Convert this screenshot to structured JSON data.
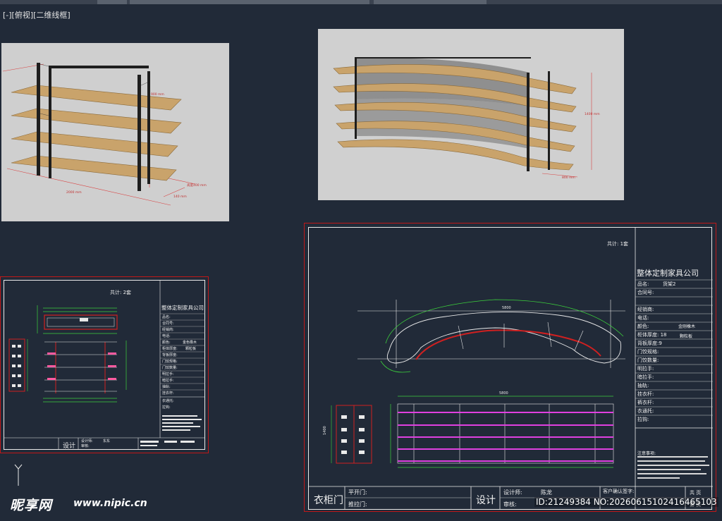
{
  "viewport": {
    "label": "[-][俯视][二维线框]"
  },
  "render_left": {
    "dims": {
      "height": "900 mm",
      "length": "2000 mm",
      "depth": "140 mm",
      "side": "高度400 mm"
    }
  },
  "render_right": {
    "dims": {
      "height": "1400 mm",
      "depth": "800 mm"
    }
  },
  "sheet_small": {
    "count": "共计: 2套",
    "company": "整体定制家具公司",
    "rows": [
      "品名:",
      "合同号:",
      "经销商:",
      "电话:",
      "颜色:",
      "柜体厚度:",
      "背板厚度:",
      "门饺规格:",
      "门饺数量:",
      "明拉手:",
      "暗拉手:",
      "抽轨:",
      "挂衣杆:",
      "衣通托:",
      "拉钩:"
    ],
    "color_value": "金色橡木",
    "board_value": "颗粒板",
    "design_label": "设计",
    "designer_label": "设计师:",
    "designer_value": "东东",
    "review_label": "审核:"
  },
  "sheet_large": {
    "count": "共计: 1套",
    "company": "整体定制家具公司",
    "rows": [
      {
        "label": "品名:",
        "value": "货架2"
      },
      {
        "label": "合同号:",
        "value": ""
      },
      {
        "label": "经销商:",
        "value": ""
      },
      {
        "label": "电话:",
        "value": ""
      },
      {
        "label": "颜色:",
        "value": "金刚橡木"
      },
      {
        "label": "柜体厚度: 18",
        "value": "颗粒板"
      },
      {
        "label": "背板厚度:9",
        "value": ""
      },
      {
        "label": "门饺规格:",
        "value": ""
      },
      {
        "label": "门饺数量:",
        "value": ""
      },
      {
        "label": "明拉手:",
        "value": ""
      },
      {
        "label": "暗拉手:",
        "value": ""
      },
      {
        "label": "抽轨:",
        "value": ""
      },
      {
        "label": "挂衣杆:",
        "value": ""
      },
      {
        "label": "裤衣杆:",
        "value": ""
      },
      {
        "label": "衣通托:",
        "value": ""
      },
      {
        "label": "拉钩:",
        "value": ""
      }
    ],
    "notes_title": "注意事项:",
    "bottom": {
      "door_label": "衣柜门",
      "flat_door": "平开门:",
      "slide_door": "推拉门:",
      "design_label": "设计",
      "designer_label": "设计师:",
      "designer_value": "陈龙",
      "review_label": "审核:",
      "confirm_label": "客户确认签字:",
      "page_a": "共 页",
      "page_b": "第 页"
    },
    "dims": {
      "top_total": "5800",
      "bottom_total": "5800",
      "left_height": "1400"
    }
  },
  "watermark": {
    "logo": "昵享网",
    "url": "www.nipic.cn",
    "id_text": "ID:21249384 NO:20260615102416465103"
  },
  "colors": {
    "background": "#212a38",
    "frame_red": "#c01818",
    "line_green": "#3cd23c",
    "shelf_magenta": "#e040e0",
    "wood": "#c9a36b",
    "metal": "#1e1e1e"
  }
}
